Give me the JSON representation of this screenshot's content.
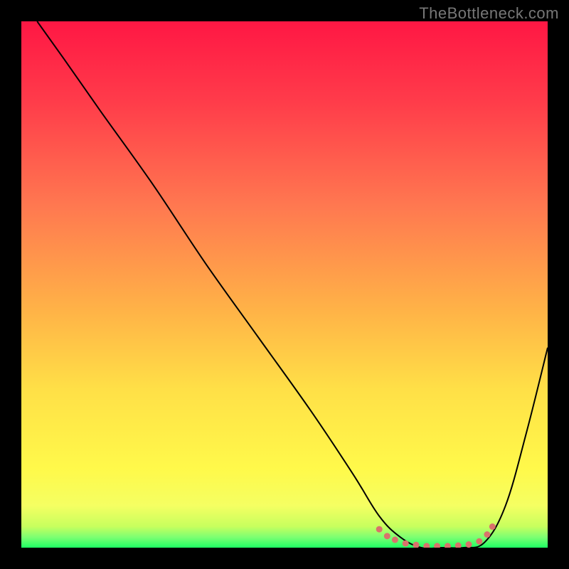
{
  "watermark": "TheBottleneck.com",
  "chart_data": {
    "type": "line",
    "title": "",
    "xlabel": "",
    "ylabel": "",
    "xlim": [
      0,
      100
    ],
    "ylim": [
      0,
      100
    ],
    "gradient_stops": [
      {
        "offset": 0,
        "color": "#ff1744"
      },
      {
        "offset": 15,
        "color": "#ff3b4a"
      },
      {
        "offset": 35,
        "color": "#ff7850"
      },
      {
        "offset": 55,
        "color": "#ffb347"
      },
      {
        "offset": 70,
        "color": "#ffe047"
      },
      {
        "offset": 85,
        "color": "#fff94a"
      },
      {
        "offset": 92,
        "color": "#f5ff62"
      },
      {
        "offset": 96,
        "color": "#c7ff5e"
      },
      {
        "offset": 98,
        "color": "#7dff72"
      },
      {
        "offset": 100,
        "color": "#1eff64"
      }
    ],
    "series": [
      {
        "name": "bottleneck-curve",
        "x": [
          3,
          8,
          15,
          25,
          35,
          45,
          55,
          63,
          68,
          72,
          76,
          80,
          84,
          88,
          92,
          96,
          100
        ],
        "y": [
          100,
          93,
          83,
          69,
          54,
          40,
          26,
          14,
          6,
          2,
          0,
          0,
          0,
          1,
          8,
          22,
          38
        ],
        "color": "#000000",
        "width": 2
      }
    ],
    "markers": {
      "name": "optimal-range",
      "color": "#d9726b",
      "points": [
        {
          "x": 68,
          "y": 3.5
        },
        {
          "x": 69.5,
          "y": 2.2
        },
        {
          "x": 71,
          "y": 1.5
        },
        {
          "x": 73,
          "y": 0.8
        },
        {
          "x": 75,
          "y": 0.5
        },
        {
          "x": 77,
          "y": 0.3
        },
        {
          "x": 79,
          "y": 0.3
        },
        {
          "x": 81,
          "y": 0.3
        },
        {
          "x": 83,
          "y": 0.4
        },
        {
          "x": 85,
          "y": 0.6
        },
        {
          "x": 87,
          "y": 1.2
        },
        {
          "x": 88.5,
          "y": 2.5
        },
        {
          "x": 89.5,
          "y": 4
        }
      ],
      "size": 9
    }
  }
}
